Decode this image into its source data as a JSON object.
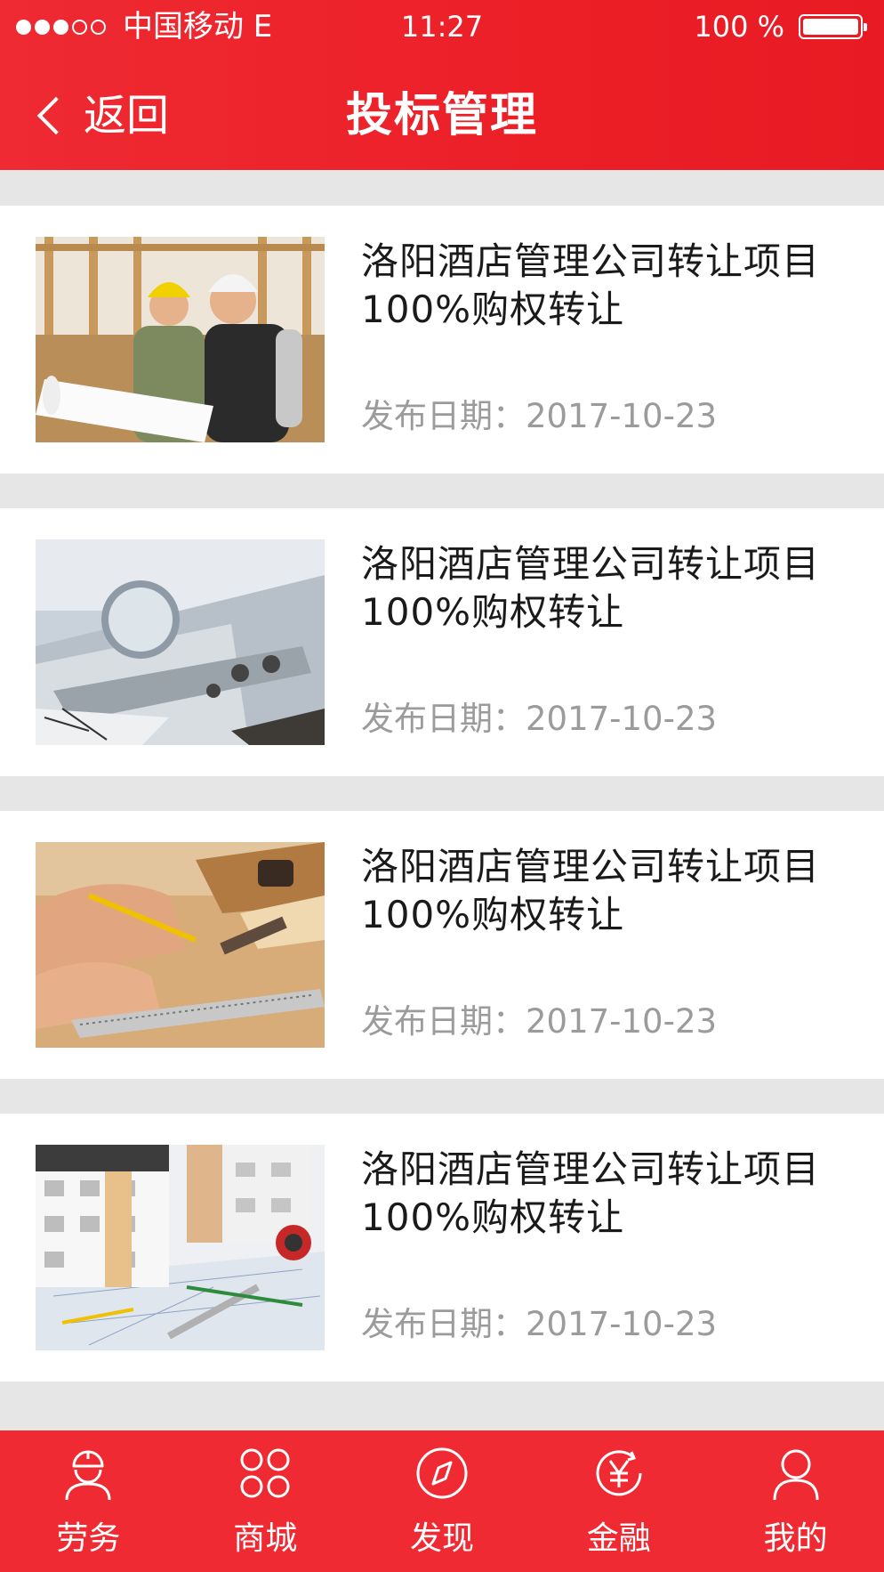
{
  "status_bar": {
    "signal_dots_filled": 3,
    "signal_dots_total": 5,
    "carrier": "中国移动 E",
    "time": "11:27",
    "battery": "100 %"
  },
  "nav": {
    "back_label": "返回",
    "title": "投标管理"
  },
  "items": [
    {
      "title": "洛阳酒店管理公司转让项目100%购权转让",
      "date": "发布日期：2017-10-23",
      "image": "construction-workers"
    },
    {
      "title": "洛阳酒店管理公司转让项目100%购权转让",
      "date": "发布日期：2017-10-23",
      "image": "drafting-tools"
    },
    {
      "title": "洛阳酒店管理公司转让项目100%购权转让",
      "date": "发布日期：2017-10-23",
      "image": "carpentry"
    },
    {
      "title": "洛阳酒店管理公司转让项目100%购权转让",
      "date": "发布日期：2017-10-23",
      "image": "building-models"
    }
  ],
  "tabs": [
    {
      "label": "劳务",
      "icon": "worker-helmet-icon"
    },
    {
      "label": "商城",
      "icon": "grid-icon"
    },
    {
      "label": "发现",
      "icon": "compass-icon"
    },
    {
      "label": "金融",
      "icon": "yen-icon"
    },
    {
      "label": "我的",
      "icon": "user-icon"
    }
  ],
  "colors": {
    "brand": "#ec1f27",
    "page_bg": "#e6e6e6",
    "date_text": "#9b9b9b"
  }
}
